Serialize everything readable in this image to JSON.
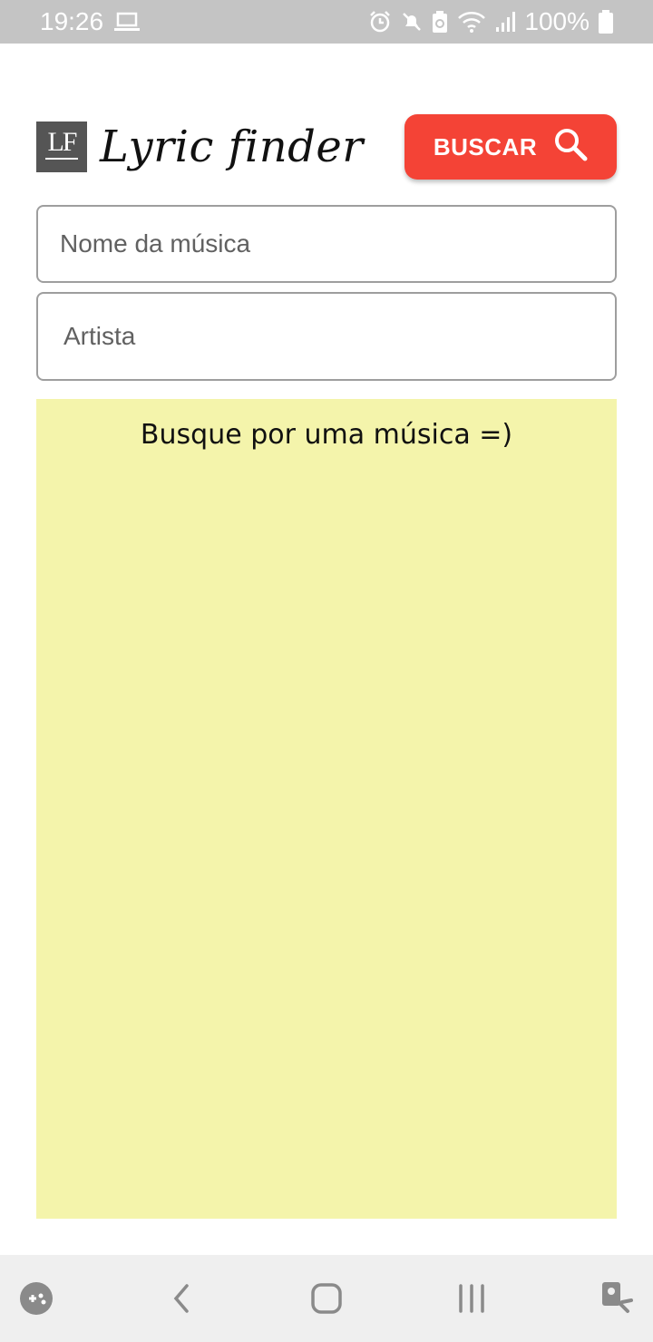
{
  "status_bar": {
    "time": "19:26",
    "battery": "100%"
  },
  "header": {
    "logo_text": "LF",
    "title": "Lyric finder",
    "search_label": "BUSCAR"
  },
  "form": {
    "song_placeholder": "Nome da música",
    "artist_placeholder": "Artista"
  },
  "results": {
    "message": "Busque por uma música =)"
  },
  "colors": {
    "accent": "#f44336",
    "results_bg": "#f4f4ab",
    "status_bar_bg": "#c4c4c4"
  },
  "icons": {
    "status": [
      "laptop-icon",
      "alarm-icon",
      "mute-icon",
      "battery-saver-icon",
      "wifi-icon",
      "signal-icon",
      "battery-icon"
    ],
    "nav": [
      "game-tools-icon",
      "back-icon",
      "home-icon",
      "recents-icon",
      "accessibility-icon"
    ],
    "search": "search-icon"
  }
}
